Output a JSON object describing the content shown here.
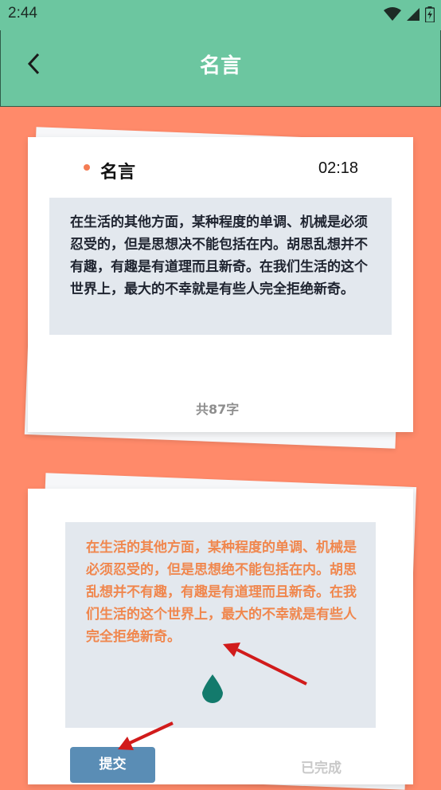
{
  "status_bar": {
    "time": "2:44",
    "icons": [
      "wifi-icon",
      "signal-icon",
      "battery-icon"
    ]
  },
  "app_bar": {
    "back_icon": "back-arrow-icon",
    "title": "名言"
  },
  "quote_card": {
    "title": "名言",
    "timer": "02:18",
    "text": "在生活的其他方面，某种程度的单调、机械是必须忍受的，但是思想决不能包括在内。胡思乱想并不有趣，有趣是有道理而且新奇。在我们生活的这个世界上，最大的不幸就是有些人完全拒绝新奇。",
    "char_count": "共87字"
  },
  "input_card": {
    "typed_text": "在生活的其他方面，某种程度的单调、机械是必须忍受的，但是思想绝不能包括在内。胡思乱想并不有趣，有趣是有道理而且新奇。在我们生活的这个世界上，最大的不幸就是有些人完全拒绝新奇。",
    "submit_label": "提交",
    "status_label": "已完成"
  },
  "colors": {
    "background": "#ff8a6a",
    "app_bar": "#6cc6a0",
    "accent_dot": "#f47c54",
    "typed_text": "#f0874e",
    "submit_button": "#5a8db5",
    "annotation_arrow": "#d11b1b"
  }
}
